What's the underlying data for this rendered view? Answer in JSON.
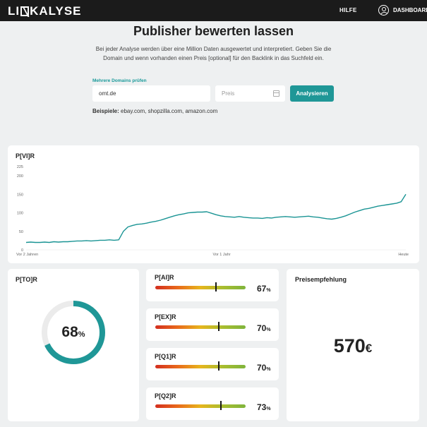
{
  "header": {
    "logo_left": "LI",
    "logo_right": "KALYSE",
    "nav_help": "HILFE",
    "nav_dashboard": "DASHBOARD"
  },
  "hero": {
    "title": "Publisher bewerten lassen",
    "description": "Bei jeder Analyse werden über eine Million Daten ausgewertet und interpretiert. Geben Sie die Domain und wenn vorhanden einen Preis [optional] für den Backlink in das Suchfeld ein.",
    "field_label": "Mehrere Domains prüfen",
    "domain_value": "omt.de",
    "price_placeholder": "Preis",
    "button_label": "Analysieren",
    "examples_label": "Beispiele:",
    "examples_text": "ebay.com, shopzilla.com, amazon.com"
  },
  "chart_card": {
    "title": "P[VI]R"
  },
  "chart_data": {
    "type": "line",
    "title": "P[VI]R",
    "ylim": [
      0,
      225
    ],
    "yticks": [
      0,
      50,
      100,
      150,
      200,
      225
    ],
    "x_tick_labels": [
      "Vor 2 Jahren",
      "Vor 1 Jahr",
      "Heute"
    ],
    "series": [
      {
        "color": "#1a9494",
        "values": [
          20,
          21,
          20,
          20,
          21,
          20,
          22,
          21,
          22,
          22,
          23,
          24,
          24,
          25,
          24,
          25,
          26,
          26,
          27,
          26,
          27,
          50,
          62,
          66,
          69,
          70,
          72,
          75,
          77,
          80,
          84,
          88,
          92,
          95,
          97,
          100,
          101,
          102,
          102,
          103,
          99,
          95,
          92,
          90,
          89,
          88,
          90,
          88,
          87,
          86,
          86,
          85,
          87,
          86,
          88,
          89,
          90,
          89,
          88,
          89,
          90,
          91,
          89,
          88,
          86,
          84,
          83,
          85,
          88,
          92,
          97,
          102,
          106,
          110,
          112,
          115,
          118,
          120,
          122,
          124,
          126,
          130,
          150
        ]
      }
    ]
  },
  "ring_card": {
    "title": "P[TO]R",
    "value": 68,
    "value_text": "68",
    "unit": "%",
    "color": "#1f9797",
    "track_color": "#ebebeb"
  },
  "bars": [
    {
      "title": "P[AI]R",
      "value": 67,
      "value_text": "67",
      "unit": "%"
    },
    {
      "title": "P[EX]R",
      "value": 70,
      "value_text": "70",
      "unit": "%"
    },
    {
      "title": "P[Q1]R",
      "value": 70,
      "value_text": "70",
      "unit": "%"
    },
    {
      "title": "P[Q2]R",
      "value": 73,
      "value_text": "73",
      "unit": "%"
    }
  ],
  "price_card": {
    "title": "Preisempfehlung",
    "value": "570",
    "currency": "€"
  }
}
